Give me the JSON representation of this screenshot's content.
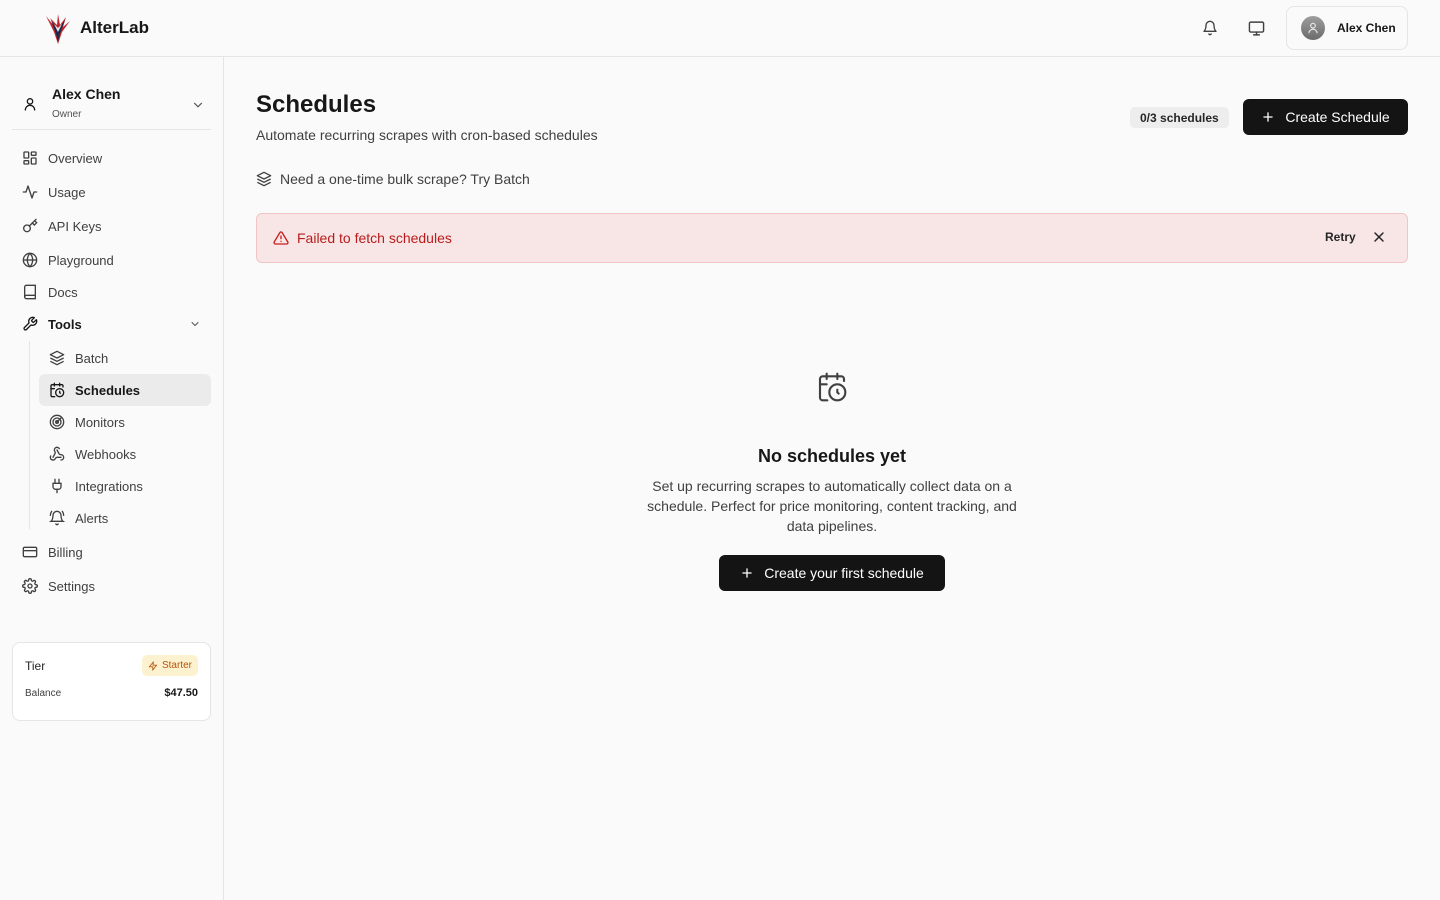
{
  "app": {
    "brand": "AlterLab"
  },
  "header": {
    "user_name": "Alex Chen",
    "icons": [
      "bell-icon",
      "monitor-icon",
      "avatar"
    ]
  },
  "sidebar": {
    "account": {
      "name": "Alex Chen",
      "role": "Owner"
    },
    "items": [
      {
        "label": "Overview",
        "icon": "grid-icon"
      },
      {
        "label": "Usage",
        "icon": "activity-icon"
      },
      {
        "label": "API Keys",
        "icon": "key-icon"
      },
      {
        "label": "Playground",
        "icon": "globe-icon"
      },
      {
        "label": "Docs",
        "icon": "book-icon"
      },
      {
        "label": "Tools",
        "icon": "wrench-icon",
        "expanded": true
      }
    ],
    "tools": [
      {
        "label": "Batch",
        "icon": "layers-icon"
      },
      {
        "label": "Schedules",
        "icon": "calendar-clock-icon",
        "active": true
      },
      {
        "label": "Monitors",
        "icon": "radar-icon"
      },
      {
        "label": "Webhooks",
        "icon": "webhook-icon"
      },
      {
        "label": "Integrations",
        "icon": "plug-icon"
      },
      {
        "label": "Alerts",
        "icon": "bell-ring-icon"
      }
    ],
    "bottom_items": [
      {
        "label": "Billing",
        "icon": "credit-card-icon"
      },
      {
        "label": "Settings",
        "icon": "gear-icon"
      }
    ],
    "tier_card": {
      "tier_label": "Tier",
      "tier_value": "Starter",
      "balance_label": "Balance",
      "balance_value": "$47.50"
    }
  },
  "main": {
    "title": "Schedules",
    "subtitle": "Automate recurring scrapes with cron-based schedules",
    "quota": "0/3 schedules",
    "create_button": "Create Schedule",
    "batch_hint": "Need a one-time bulk scrape? Try Batch",
    "alert": {
      "message": "Failed to fetch schedules",
      "retry": "Retry"
    },
    "empty_state": {
      "title": "No schedules yet",
      "description": "Set up recurring scrapes to automatically collect data on a schedule. Perfect for price monitoring, content tracking, and data pipelines.",
      "button": "Create your first schedule"
    }
  },
  "colors": {
    "accent_dark": "#141414",
    "alert_bg": "#f8e6e6",
    "alert_text": "#b91c1c",
    "badge_bg": "#fdf2d0",
    "badge_text": "#b45309"
  }
}
